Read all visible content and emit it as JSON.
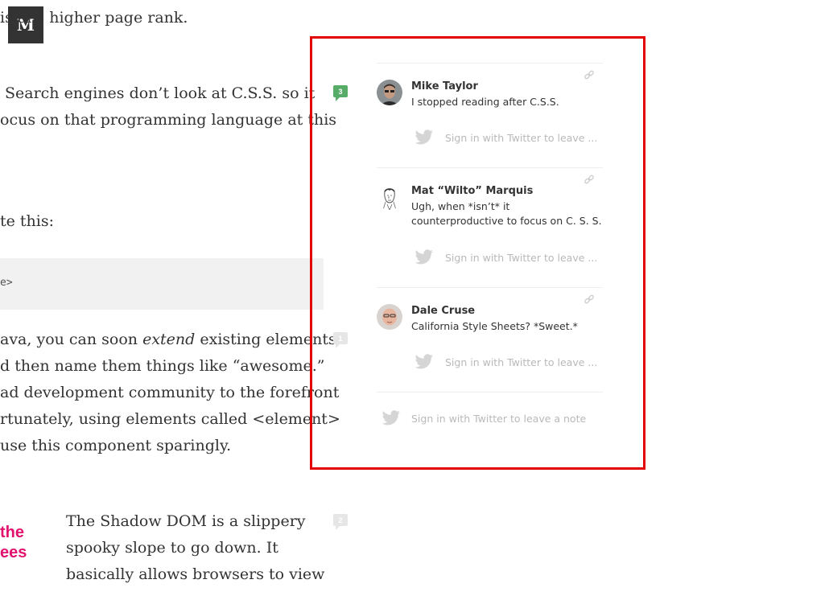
{
  "logo": {
    "letter": "M"
  },
  "article": {
    "lines": [
      "is   ans higher page rank.",
      " Search engines don’t look at C.S.S. so it",
      "ocus on that programming language at this",
      "te this:",
      "ava, you can soon ",
      "d then name them things like “awesome.”",
      "ad development community to the forefront",
      "rtunately, using elements called <element>",
      "use this component sparingly.",
      "The Shadow DOM is a slippery",
      "spooky slope to go down. It",
      "basically allows browsers to view"
    ],
    "italic_word": "extend",
    "line5_rest": " existing elements",
    "code": "e>",
    "thumb_words": [
      "the",
      "ees"
    ]
  },
  "badges": [
    {
      "count": "3",
      "color": "#57ad68"
    },
    {
      "count": "1",
      "color": "#e6e6e6"
    },
    {
      "count": "2",
      "color": "#e6e6e6"
    }
  ],
  "notes": [
    {
      "author": "Mike Taylor",
      "text": "I stopped reading after C.S.S.",
      "reply_placeholder": "Sign in with Twitter to leave ..."
    },
    {
      "author": "Mat “Wilto” Marquis",
      "text": "Ugh, when *isn’t* it counterproductive to focus on C. S. S.",
      "reply_placeholder": "Sign in with Twitter to leave ..."
    },
    {
      "author": "Dale Cruse",
      "text": "California Style Sheets? *Sweet.*",
      "reply_placeholder": "Sign in with Twitter to leave ..."
    }
  ],
  "leave_note": "Sign in with Twitter to leave a note",
  "colors": {
    "highlight": "#e30000",
    "note_badge": "#57ad68",
    "placeholder": "#b9b9b9"
  }
}
